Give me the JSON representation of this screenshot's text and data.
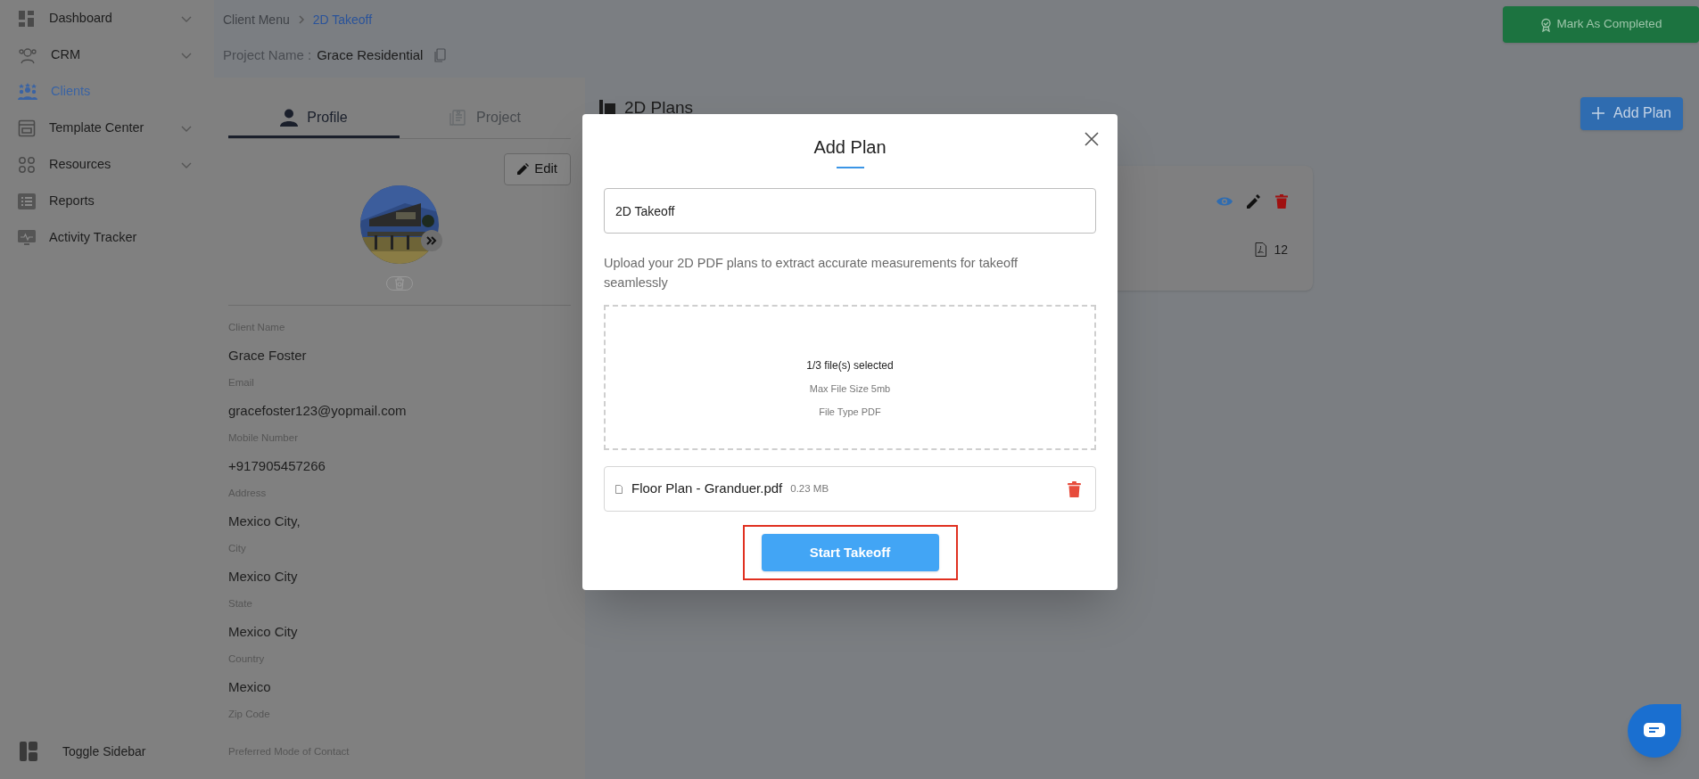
{
  "sidebar": {
    "items": [
      {
        "label": "Dashboard",
        "selected": false,
        "expandable": true
      },
      {
        "label": "CRM",
        "selected": false,
        "expandable": true
      },
      {
        "label": "Clients",
        "selected": true,
        "expandable": false
      },
      {
        "label": "Template Center",
        "selected": false,
        "expandable": true
      },
      {
        "label": "Resources",
        "selected": false,
        "expandable": true
      },
      {
        "label": "Reports",
        "selected": false,
        "expandable": false
      },
      {
        "label": "Activity Tracker",
        "selected": false,
        "expandable": false
      }
    ],
    "toggle": "Toggle Sidebar"
  },
  "breadcrumb": [
    {
      "label": "Client Menu",
      "current": false
    },
    {
      "label": "2D Takeoff",
      "current": true
    }
  ],
  "project": {
    "label": "Project Name :",
    "value": "Grace Residential"
  },
  "mark_completed": "Mark As Completed",
  "profile_panel": {
    "tabs": [
      {
        "label": "Profile",
        "selected": true
      },
      {
        "label": "Project",
        "selected": false
      }
    ],
    "edit": "Edit",
    "fields": [
      {
        "label": "Client Name",
        "value": "Grace Foster"
      },
      {
        "label": "Email",
        "value": "gracefoster123@yopmail.com"
      },
      {
        "label": "Mobile Number",
        "value": "+917905457266"
      },
      {
        "label": "Address",
        "value": "Mexico City,"
      },
      {
        "label": "City",
        "value": "Mexico City"
      },
      {
        "label": "State",
        "value": "Mexico City"
      },
      {
        "label": "Country",
        "value": "Mexico"
      },
      {
        "label": "Zip Code"
      },
      {
        "label": "Preferred Mode of Contact"
      }
    ]
  },
  "plans": {
    "title": "2D Plans",
    "add_button": "Add Plan",
    "cards": [
      {
        "file_count": "12"
      }
    ]
  },
  "modal": {
    "title": "Add Plan",
    "name_value": "2D Takeoff",
    "description": "Upload your 2D PDF plans to extract accurate measurements for takeoff seamlessly",
    "dropzone": {
      "selected": "1/3 file(s) selected",
      "max_size": "Max File Size 5mb",
      "file_type": "File Type PDF"
    },
    "files": [
      {
        "name": "Floor Plan - Granduer.pdf",
        "size": "0.23 MB"
      }
    ],
    "submit": "Start Takeoff"
  }
}
